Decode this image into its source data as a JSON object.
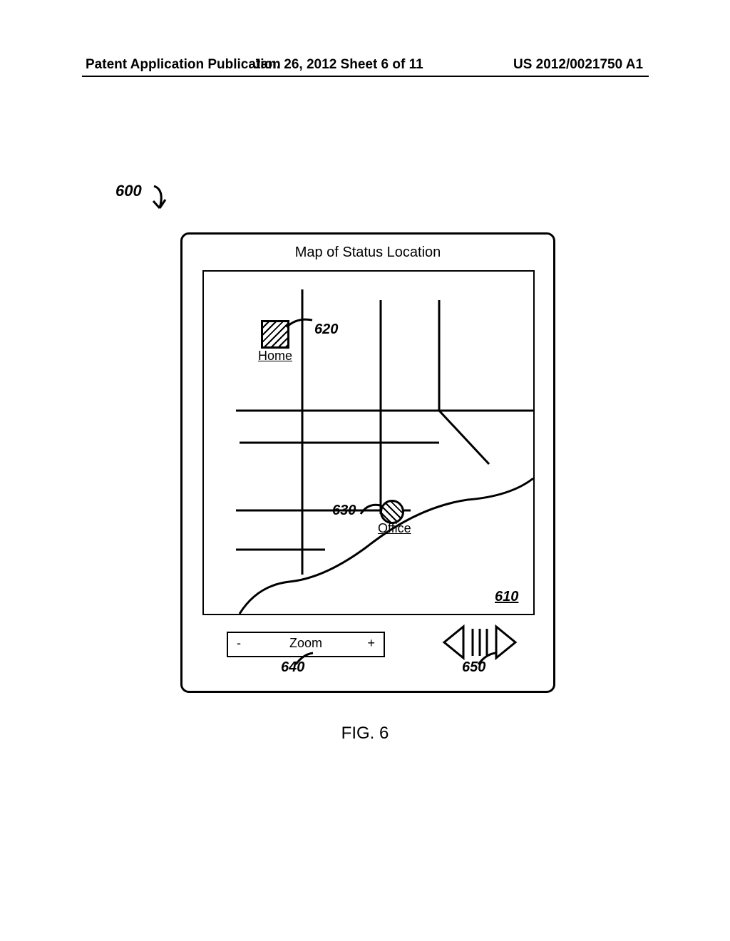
{
  "header": {
    "left": "Patent Application Publication",
    "center": "Jan. 26, 2012  Sheet 6 of 11",
    "right": "US 2012/0021750 A1"
  },
  "refs": {
    "r600": "600",
    "r610": "610",
    "r620": "620",
    "r630": "630",
    "r640": "640",
    "r650": "650"
  },
  "map": {
    "title": "Map of Status Location",
    "home_label": "Home",
    "office_label": "Office"
  },
  "zoom": {
    "minus": "-",
    "label": "Zoom",
    "plus": "+"
  },
  "figure_caption": "FIG. 6"
}
